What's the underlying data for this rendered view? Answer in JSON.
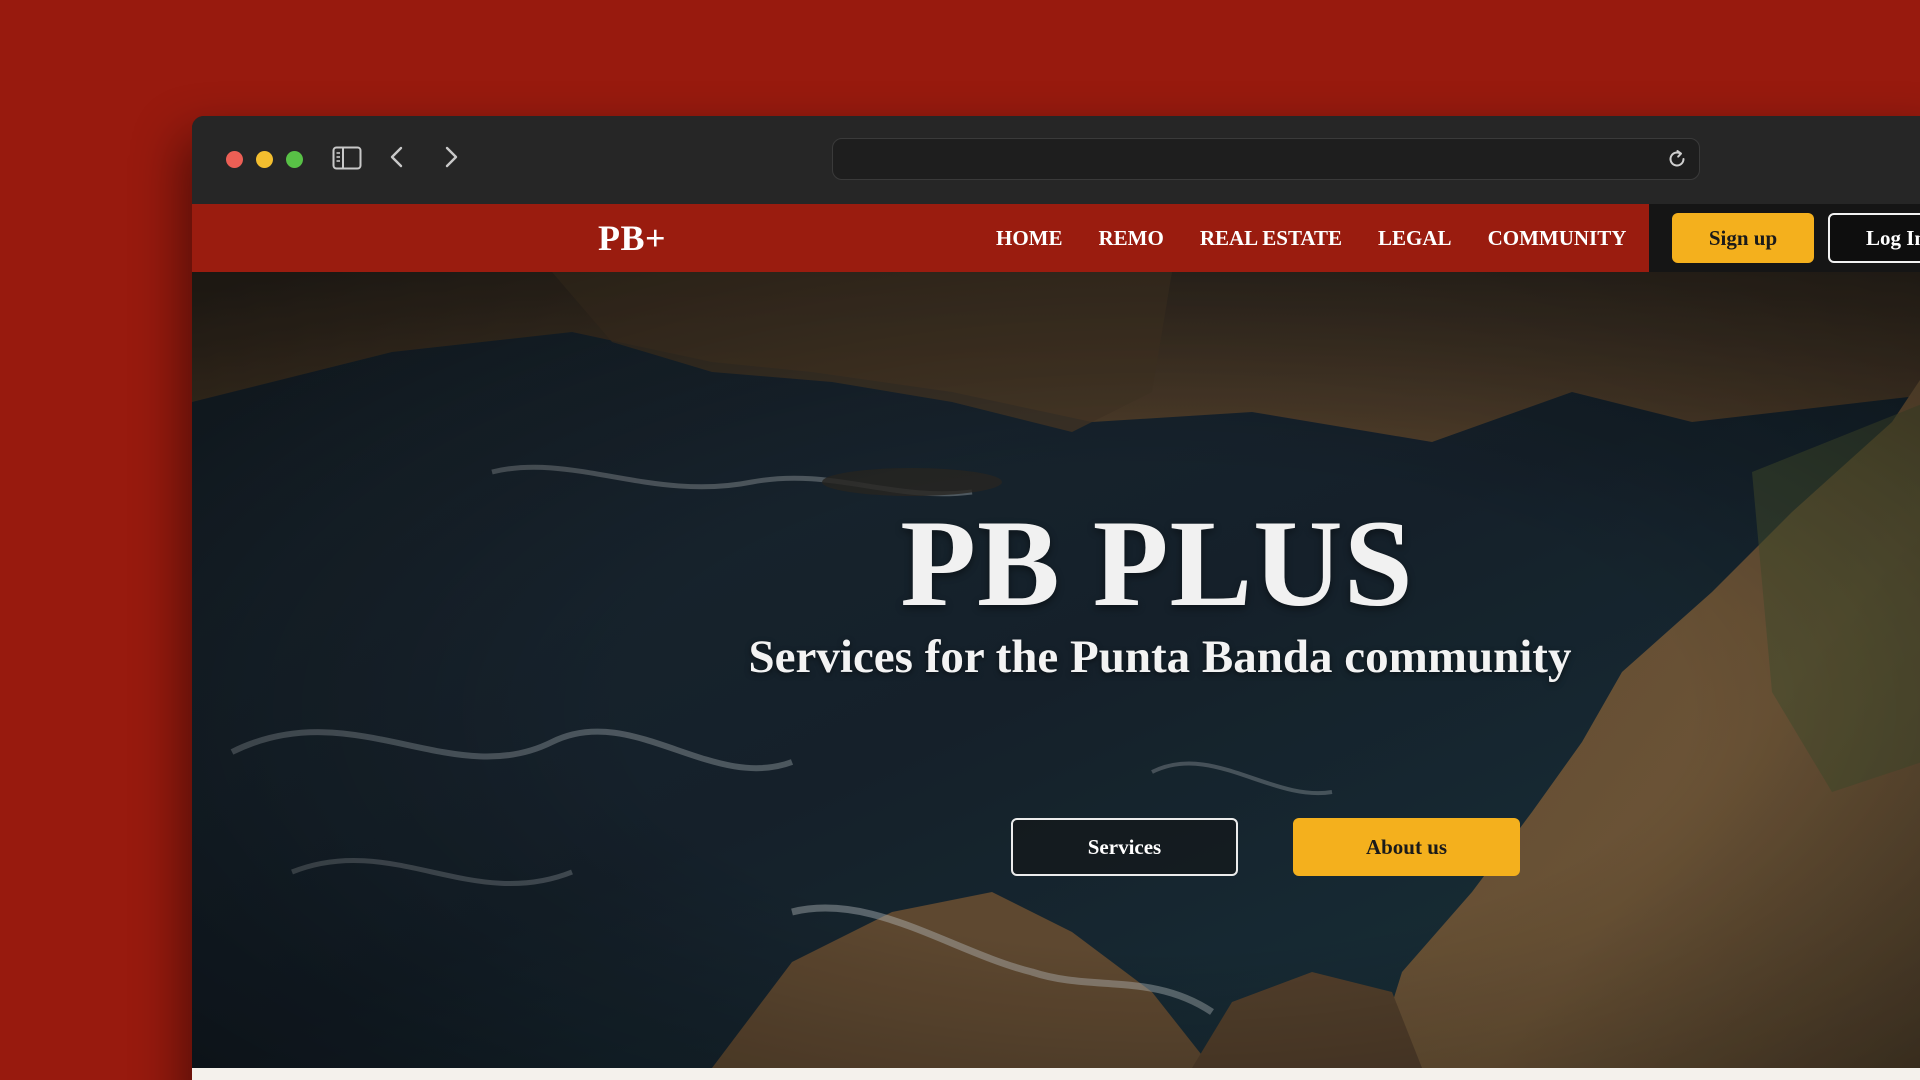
{
  "browser": {
    "icons": {
      "sidebar": "sidebar-toggle-icon",
      "back": "chevron-left-icon",
      "forward": "chevron-right-icon",
      "reload": "reload-icon"
    },
    "address": ""
  },
  "site": {
    "logo": "PB+",
    "nav": [
      "HOME",
      "REMO",
      "REAL ESTATE",
      "LEGAL",
      "COMMUNITY"
    ],
    "signup_label": "Sign up",
    "login_label": "Log In"
  },
  "hero": {
    "title": "PB PLUS",
    "subtitle": "Services for the Punta Banda community",
    "services_label": "Services",
    "about_label": "About us"
  },
  "colors": {
    "background": "#981a0e",
    "header": "#9a1c0f",
    "accent": "#f4b01d",
    "titlebar": "#262626"
  }
}
